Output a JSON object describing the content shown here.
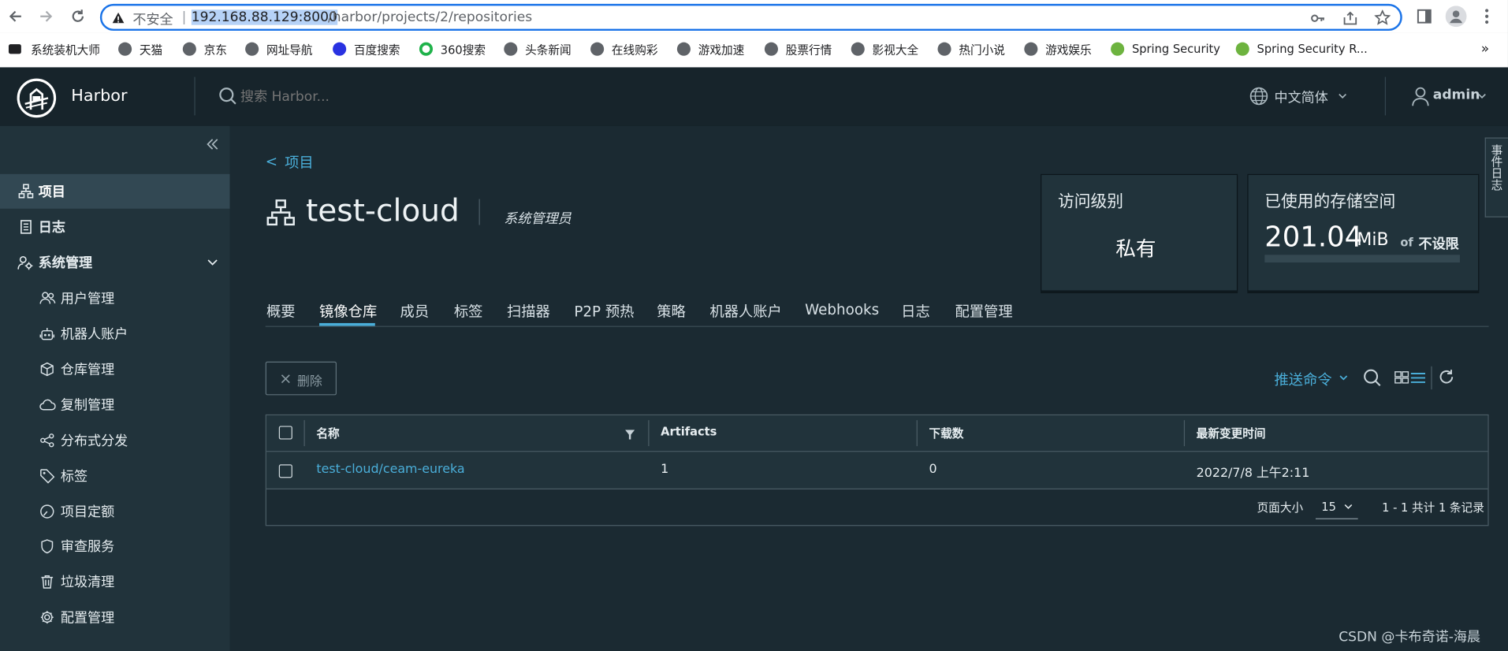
{
  "browser": {
    "security_label": "不安全",
    "url_host": "192.168.88.129:8000",
    "url_path": "/harbor/projects/2/repositories",
    "bookmarks": [
      {
        "label": "系统装机大师"
      },
      {
        "label": "天猫"
      },
      {
        "label": "京东"
      },
      {
        "label": "网址导航"
      },
      {
        "label": "百度搜索"
      },
      {
        "label": "360搜索"
      },
      {
        "label": "头条新闻"
      },
      {
        "label": "在线购彩"
      },
      {
        "label": "游戏加速"
      },
      {
        "label": "股票行情"
      },
      {
        "label": "影视大全"
      },
      {
        "label": "热门小说"
      },
      {
        "label": "游戏娱乐"
      },
      {
        "label": "Spring Security"
      },
      {
        "label": "Spring Security R..."
      }
    ],
    "more_bookmarks": "»"
  },
  "header": {
    "app_name": "Harbor",
    "search_placeholder": "搜索 Harbor...",
    "language": "中文简体",
    "user": "admin"
  },
  "sidebar": {
    "items": [
      {
        "label": "项目",
        "icon": "projects-icon"
      },
      {
        "label": "日志",
        "icon": "logs-icon"
      },
      {
        "label": "系统管理",
        "icon": "admin-icon"
      },
      {
        "label": "用户管理",
        "icon": "users-icon"
      },
      {
        "label": "机器人账户",
        "icon": "robot-icon"
      },
      {
        "label": "仓库管理",
        "icon": "registry-icon"
      },
      {
        "label": "复制管理",
        "icon": "replication-icon"
      },
      {
        "label": "分布式分发",
        "icon": "distribution-icon"
      },
      {
        "label": "标签",
        "icon": "tag-icon"
      },
      {
        "label": "项目定额",
        "icon": "quota-icon"
      },
      {
        "label": "审查服务",
        "icon": "shield-icon"
      },
      {
        "label": "垃圾清理",
        "icon": "trash-icon"
      },
      {
        "label": "配置管理",
        "icon": "gear-icon"
      }
    ]
  },
  "project": {
    "back_label": "项目",
    "name": "test-cloud",
    "role": "系统管理员",
    "access_title": "访问级别",
    "access_value": "私有",
    "storage_title": "已使用的存储空间",
    "storage_value": "201.04",
    "storage_unit": "MiB",
    "storage_of": "of",
    "storage_limit": "不设限",
    "tabs": [
      "概要",
      "镜像仓库",
      "成员",
      "标签",
      "扫描器",
      "P2P 预热",
      "策略",
      "机器人账户",
      "Webhooks",
      "日志",
      "配置管理"
    ],
    "active_tab": "镜像仓库"
  },
  "toolbar": {
    "delete_label": "删除",
    "push_command": "推送命令"
  },
  "table": {
    "headers": [
      "名称",
      "Artifacts",
      "下载数",
      "最新变更时间"
    ],
    "rows": [
      {
        "name": "test-cloud/ceam-eureka",
        "artifacts": "1",
        "downloads": "0",
        "updated": "2022/7/8 上午2:11"
      }
    ],
    "page_size_label": "页面大小",
    "page_size": "15",
    "summary": "1 - 1 共计 1 条记录"
  },
  "side_tab": "事件日志",
  "watermark": "CSDN @卡布奇诺-海晨",
  "colors": {
    "accent": "#4aaed9",
    "header_bg": "#17242b",
    "sidebar_bg": "#21333b",
    "content_bg": "#1b2a32"
  }
}
